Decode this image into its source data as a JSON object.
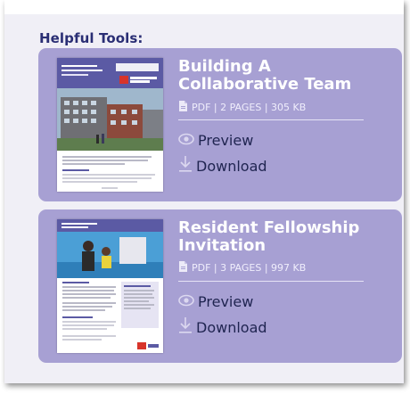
{
  "heading": "Helpful Tools:",
  "cards": [
    {
      "title": "Building A Collaborative Team",
      "meta": "PDF | 2 PAGES | 305 KB",
      "preview_label": "Preview",
      "download_label": "Download",
      "thumb": {
        "title": "Building A Collaborative Team: Types of Teams",
        "org1": "Partnership for Neighborhood",
        "org2": "DESIGN IMPACT"
      }
    },
    {
      "title": "Resident Fellowship Invitation",
      "meta": "PDF | 3 PAGES | 997 KB",
      "preview_label": "Preview",
      "download_label": "Download",
      "thumb": {
        "title": "RESIDENT FELLOWSHIP INVITATION",
        "section1": "The Challenge",
        "section2": "About the Project"
      }
    }
  ],
  "colors": {
    "card": "#a7a0d3",
    "heading": "#2a2e74",
    "action_text": "#1f2450",
    "panel": "#f0eff6"
  }
}
